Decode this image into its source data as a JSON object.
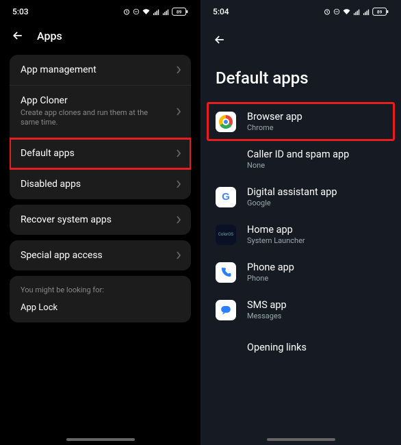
{
  "left": {
    "status": {
      "time": "5:03",
      "battery": "89"
    },
    "title": "Apps",
    "group1": [
      {
        "title": "App management",
        "sub": null
      },
      {
        "title": "App Cloner",
        "sub": "Create app clones and run them at the same time."
      },
      {
        "title": "Default apps",
        "sub": null,
        "highlight": true
      },
      {
        "title": "Disabled apps",
        "sub": null
      }
    ],
    "group2": [
      {
        "title": "Recover system apps"
      }
    ],
    "group3": [
      {
        "title": "Special app access"
      }
    ],
    "hint_label": "You might be looking for:",
    "hint_item": "App Lock"
  },
  "right": {
    "status": {
      "time": "5:04",
      "battery": "89"
    },
    "title": "Default apps",
    "items": [
      {
        "title": "Browser app",
        "sub": "Chrome",
        "icon": "chrome",
        "highlight": true
      },
      {
        "title": "Caller ID and spam app",
        "sub": "None",
        "icon": "none"
      },
      {
        "title": "Digital assistant app",
        "sub": "Google",
        "icon": "google"
      },
      {
        "title": "Home app",
        "sub": "System Launcher",
        "icon": "coloros"
      },
      {
        "title": "Phone app",
        "sub": "Phone",
        "icon": "phone"
      },
      {
        "title": "SMS app",
        "sub": "Messages",
        "icon": "sms"
      },
      {
        "title": "Opening links",
        "sub": null,
        "icon": "none"
      }
    ]
  }
}
